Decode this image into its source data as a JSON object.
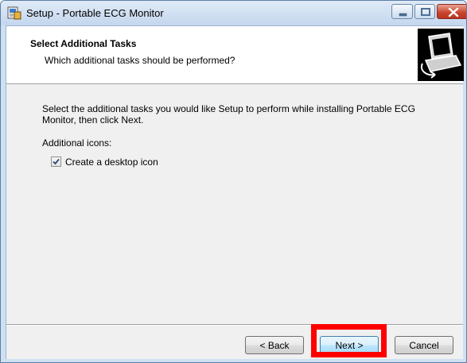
{
  "window": {
    "title": "Setup - Portable ECG Monitor"
  },
  "header": {
    "title": "Select Additional Tasks",
    "subtitle": "Which additional tasks should be performed?"
  },
  "content": {
    "description": "Select the additional tasks you would like Setup to perform while installing Portable ECG Monitor, then click Next.",
    "group_label": "Additional icons:",
    "tasks": [
      {
        "label": "Create a desktop icon",
        "checked": true
      }
    ]
  },
  "buttons": {
    "back": "< Back",
    "next": "Next >",
    "cancel": "Cancel"
  },
  "colors": {
    "highlight": "#ff0000",
    "titlebar": "#c4d7ee",
    "close_button": "#c7432b"
  }
}
